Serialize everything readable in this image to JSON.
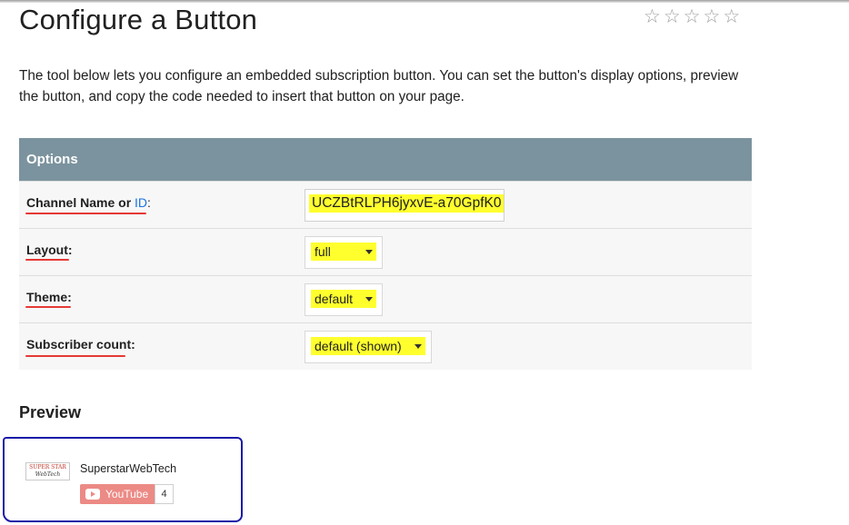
{
  "page": {
    "title": "Configure a Button",
    "rating_stars": [
      "☆",
      "☆",
      "☆",
      "☆",
      "☆"
    ],
    "intro": "The tool below lets you configure an embedded subscription button. You can set the button's display options, preview the button, and copy the code needed to insert that button on your page."
  },
  "options": {
    "header": "Options",
    "channel": {
      "label": "Channel Name or ",
      "link": "ID",
      "colon": ":",
      "value": "UCZBtRLPH6jyxvE-a70GpfK0"
    },
    "layout": {
      "label": "Layout:",
      "value": "full"
    },
    "theme": {
      "label": "Theme:",
      "value": "default"
    },
    "count": {
      "label": "Subscriber count:",
      "value": "default (shown)"
    }
  },
  "preview": {
    "title": "Preview",
    "logo_line1": "SUPER STAR",
    "logo_line2": "WebTech",
    "channel_name": "SuperstarWebTech",
    "button_label": "YouTube",
    "subscriber_count": "4"
  },
  "colors": {
    "header_bg": "#7b939e",
    "highlight": "#ffff2e",
    "annotation_underline": "#e53935",
    "annotation_box": "#1a1aa8",
    "youtube_button": "#ec8a85"
  },
  "icons": {
    "rating": "star-outline-icon",
    "dropdown": "caret-down-icon",
    "youtube": "youtube-play-icon"
  }
}
